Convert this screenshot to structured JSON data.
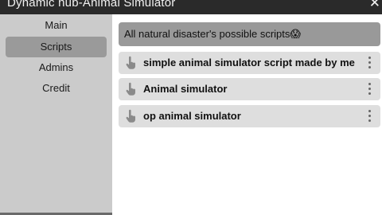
{
  "window": {
    "title": "Dynamic hub-Animal Simulator",
    "close_glyph": "✕"
  },
  "sidebar": {
    "items": [
      {
        "label": "Main",
        "active": false
      },
      {
        "label": "Scripts",
        "active": true
      },
      {
        "label": "Admins",
        "active": false
      },
      {
        "label": "Credit",
        "active": false
      }
    ]
  },
  "main": {
    "header": "All natural disaster's possible scripts😱",
    "scripts": [
      {
        "label": "simple animal simulator script made by me",
        "icon": "pointer-hand-icon"
      },
      {
        "label": "Animal simulator",
        "icon": "pointer-hand-icon"
      },
      {
        "label": "op animal simulator",
        "icon": "pointer-hand-icon"
      }
    ]
  },
  "colors": {
    "titlebar": "#2a2a2a",
    "sidebar": "#cbcbcb",
    "active_item": "#9a9a9a",
    "header_bar": "#999999",
    "row": "#dedede"
  }
}
